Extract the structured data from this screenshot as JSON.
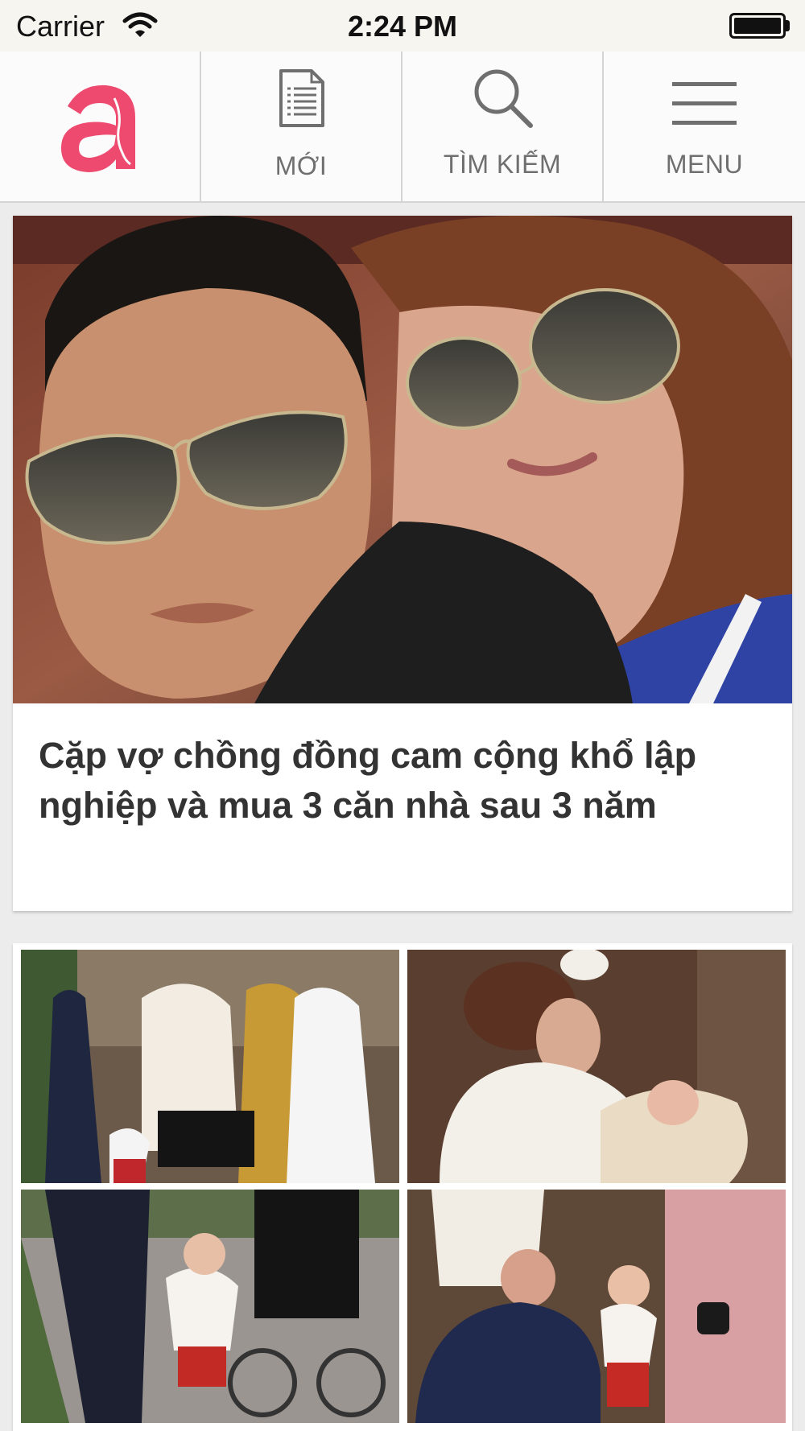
{
  "status_bar": {
    "carrier": "Carrier",
    "time": "2:24 PM"
  },
  "nav": {
    "items": [
      {
        "label": "MỚI",
        "icon": "document-icon"
      },
      {
        "label": "TÌM KIẾM",
        "icon": "search-icon"
      },
      {
        "label": "MENU",
        "icon": "hamburger-menu-icon"
      }
    ]
  },
  "feed": {
    "articles": [
      {
        "title": "Cặp vợ chồng đồng cam cộng khổ lập nghiệp và mua 3 căn nhà sau 3 năm"
      }
    ]
  },
  "colors": {
    "brand": "#ee4a6f",
    "nav_text": "#6f6f6f",
    "headline_text": "#333333",
    "background": "#ececec"
  }
}
